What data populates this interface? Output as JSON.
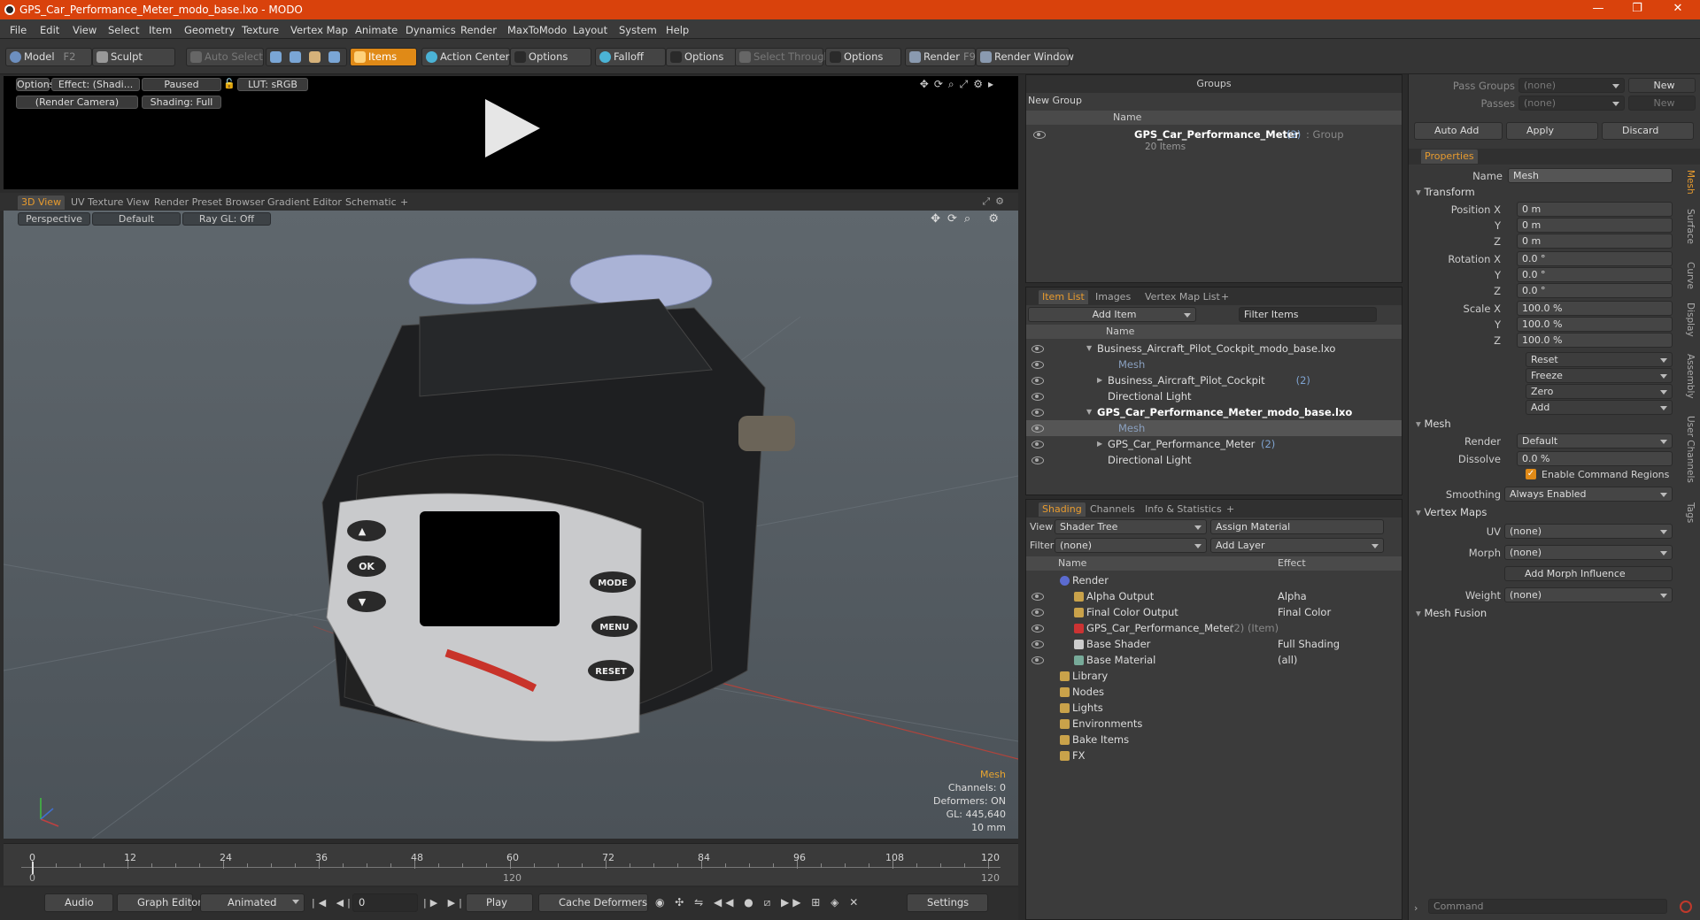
{
  "window": {
    "title": "GPS_Car_Performance_Meter_modo_base.lxo - MODO",
    "controls": [
      "—",
      "❐",
      "✕"
    ]
  },
  "menu": [
    "File",
    "Edit",
    "View",
    "Select",
    "Item",
    "Geometry",
    "Texture",
    "Vertex Map",
    "Animate",
    "Dynamics",
    "Render",
    "MaxToModo",
    "Layout",
    "System",
    "Help"
  ],
  "toolbar": {
    "model": "Model",
    "model_key": "F2",
    "sculpt": "Sculpt",
    "auto_select": "Auto Select",
    "items": "Items",
    "action_center": "Action Center",
    "options1": "Options",
    "falloff": "Falloff",
    "options2": "Options",
    "select_through": "Select Through",
    "options3": "Options",
    "render": "Render",
    "render_key": "F9",
    "render_window": "Render Window"
  },
  "preview": {
    "options": "Options",
    "effect": "Effect: (Shadi...",
    "paused": "Paused",
    "lut": "LUT: sRGB",
    "camera": "(Render Camera)",
    "shading": "Shading: Full"
  },
  "viewport_tabs": [
    "3D View",
    "UV Texture View",
    "Render Preset Browser",
    "Gradient Editor",
    "Schematic",
    "+"
  ],
  "viewport": {
    "perspective": "Perspective",
    "default": "Default",
    "raygl": "Ray GL: Off",
    "hud": {
      "title": "Mesh",
      "channels": "Channels: 0",
      "deformers": "Deformers: ON",
      "gl": "GL: 445,640",
      "unit": "10 mm"
    },
    "buttons": {
      "up": "▲",
      "ok": "OK",
      "down": "▼",
      "mode": "MODE",
      "menu": "MENU",
      "reset": "RESET"
    }
  },
  "timeline": {
    "ticks": [
      "0",
      "12",
      "24",
      "36",
      "48",
      "60",
      "72",
      "84",
      "96",
      "108",
      "120"
    ],
    "ticks_bottom": [
      "0",
      "120",
      "120"
    ]
  },
  "bottom": {
    "audio": "Audio",
    "graph_editor": "Graph Editor",
    "animated": "Animated",
    "frame": "0",
    "play": "Play",
    "cache_deformers": "Cache Deformers",
    "settings": "Settings"
  },
  "groups": {
    "title": "Groups",
    "new_group": "New Group",
    "col_name": "Name",
    "item_name": "GPS_Car_Performance_Meter",
    "item_count": "(3)",
    "item_type": ": Group",
    "item_sub": "20 Items"
  },
  "itemlist": {
    "tabs": [
      "Item List",
      "Images",
      "Vertex Map List",
      "+"
    ],
    "add_item": "Add Item",
    "filter": "Filter Items",
    "col_name": "Name",
    "rows": [
      {
        "label": "Business_Aircraft_Pilot_Cockpit_modo_base.lxo",
        "indent": 0,
        "bold": false,
        "arrow": "▼"
      },
      {
        "label": "Mesh",
        "indent": 2,
        "bold": false,
        "arrow": "",
        "dim": true
      },
      {
        "label": "Business_Aircraft_Pilot_Cockpit",
        "count": "(2)",
        "indent": 1,
        "bold": false,
        "arrow": "▶"
      },
      {
        "label": "Directional Light",
        "indent": 1,
        "bold": false,
        "arrow": ""
      },
      {
        "label": "GPS_Car_Performance_Meter_modo_base.lxo",
        "indent": 0,
        "bold": true,
        "arrow": "▼"
      },
      {
        "label": "Mesh",
        "indent": 2,
        "bold": false,
        "arrow": "",
        "dim": true,
        "selected": true
      },
      {
        "label": "GPS_Car_Performance_Meter",
        "count": "(2)",
        "indent": 1,
        "bold": false,
        "arrow": "▶"
      },
      {
        "label": "Directional Light",
        "indent": 1,
        "bold": false,
        "arrow": ""
      }
    ]
  },
  "shading": {
    "tabs": [
      "Shading",
      "Channels",
      "Info & Statistics",
      "+"
    ],
    "view_label": "View",
    "view_value": "Shader Tree",
    "assign_material": "Assign Material",
    "filter_label": "Filter",
    "filter_value": "(none)",
    "add_layer": "Add Layer",
    "col_name": "Name",
    "col_effect": "Effect",
    "rows": [
      {
        "name": "Render",
        "effect": "",
        "indent": 0
      },
      {
        "name": "Alpha Output",
        "effect": "Alpha",
        "indent": 1
      },
      {
        "name": "Final Color Output",
        "effect": "Final Color",
        "indent": 1
      },
      {
        "name": "GPS_Car_Performance_Meter",
        "extra": "(2) (Item)",
        "effect": "",
        "indent": 1
      },
      {
        "name": "Base Shader",
        "effect": "Full Shading",
        "indent": 1
      },
      {
        "name": "Base Material",
        "effect": "(all)",
        "indent": 1
      },
      {
        "name": "Library",
        "effect": "",
        "indent": 0
      },
      {
        "name": "Nodes",
        "effect": "",
        "indent": 0
      },
      {
        "name": "Lights",
        "effect": "",
        "indent": 0
      },
      {
        "name": "Environments",
        "effect": "",
        "indent": 0
      },
      {
        "name": "Bake Items",
        "effect": "",
        "indent": 0
      },
      {
        "name": "FX",
        "effect": "",
        "indent": 0
      }
    ]
  },
  "passes": {
    "pass_groups": "Pass Groups",
    "passes": "Passes",
    "none": "(none)",
    "new": "New",
    "auto_add": "Auto Add",
    "apply": "Apply",
    "discard": "Discard"
  },
  "properties": {
    "tab": "Properties",
    "name_label": "Name",
    "name_value": "Mesh",
    "transform": "Transform",
    "position_label": "Position X",
    "rotation_label": "Rotation X",
    "scale_label": "Scale X",
    "y": "Y",
    "z": "Z",
    "pos": [
      "0 m",
      "0 m",
      "0 m"
    ],
    "rot": [
      "0.0 °",
      "0.0 °",
      "0.0 °"
    ],
    "scale": [
      "100.0 %",
      "100.0 %",
      "100.0 %"
    ],
    "reset": "Reset",
    "freeze": "Freeze",
    "zero": "Zero",
    "add": "Add",
    "mesh": "Mesh",
    "render_label": "Render",
    "render_value": "Default",
    "dissolve_label": "Dissolve",
    "dissolve_value": "0.0 %",
    "enable_cmd": "Enable Command Regions",
    "smoothing_label": "Smoothing",
    "smoothing_value": "Always Enabled",
    "vertex_maps": "Vertex Maps",
    "uv_label": "UV",
    "uv_value": "(none)",
    "morph_label": "Morph",
    "morph_value": "(none)",
    "add_morph": "Add Morph Influence",
    "weight_label": "Weight",
    "weight_value": "(none)",
    "mesh_fusion": "Mesh Fusion",
    "side_tabs": [
      "Mesh",
      "Surface",
      "Curve",
      "Display",
      "Assembly",
      "User Channels",
      "Tags"
    ],
    "command": "Command"
  }
}
